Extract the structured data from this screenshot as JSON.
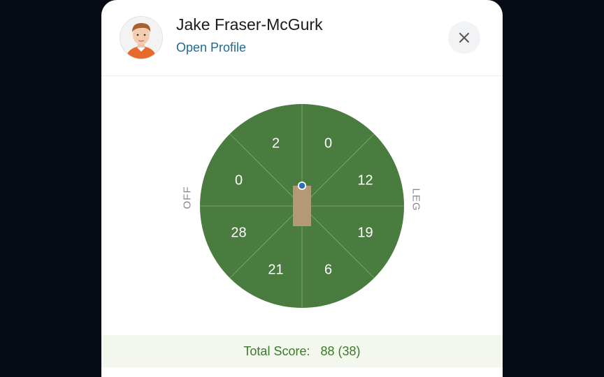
{
  "player": {
    "name": "Jake Fraser-McGurk",
    "profile_link": "Open Profile",
    "avatar_icon": "player-avatar"
  },
  "close_icon": "close-icon",
  "wagon_wheel": {
    "off_label": "OFF",
    "leg_label": "LEG",
    "segments": [
      {
        "zone": "off-straight",
        "runs": "2"
      },
      {
        "zone": "leg-straight",
        "runs": "0"
      },
      {
        "zone": "leg-mid",
        "runs": "12"
      },
      {
        "zone": "leg-square",
        "runs": "19"
      },
      {
        "zone": "leg-fine",
        "runs": "6"
      },
      {
        "zone": "third-man",
        "runs": "21"
      },
      {
        "zone": "off-square",
        "runs": "28"
      },
      {
        "zone": "off-cover",
        "runs": "0"
      }
    ],
    "field_color": "#4a7b3f",
    "pitch_color": "#b49a74",
    "ball_color": "#2f6fb0"
  },
  "total": {
    "label": "Total Score:",
    "value": "88 (38)"
  }
}
